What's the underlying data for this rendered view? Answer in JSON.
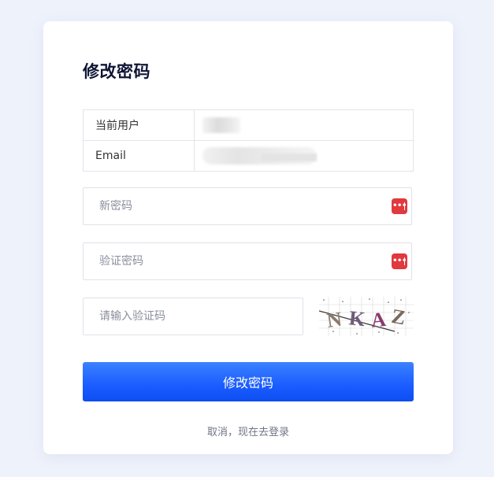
{
  "form": {
    "title": "修改密码",
    "user_info": {
      "current_user_label": "当前用户",
      "email_label": "Email"
    },
    "new_password_placeholder": "新密码",
    "confirm_password_placeholder": "验证密码",
    "captcha_placeholder": "请输入验证码",
    "captcha_text": "NKAZ",
    "submit_label": "修改密码",
    "cancel_link": "取消，现在去登录"
  },
  "colors": {
    "background": "#eef2fb",
    "primary_button": "#1a5cff",
    "password_icon": "#e0393e",
    "title": "#0f1535"
  },
  "icons": {
    "password_field": "password-manager-key-icon"
  }
}
